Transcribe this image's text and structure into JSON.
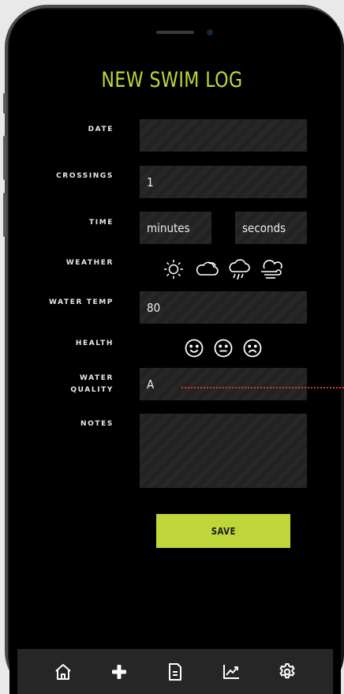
{
  "title": "NEW SWIM LOG",
  "form": {
    "date": {
      "label": "DATE",
      "value": ""
    },
    "crossings": {
      "label": "CROSSINGS",
      "value": "1"
    },
    "time": {
      "label": "TIME",
      "minutes_placeholder": "minutes",
      "seconds_placeholder": "seconds"
    },
    "weather": {
      "label": "WEATHER",
      "options": [
        "sun-icon",
        "cloud-icon",
        "rain-icon",
        "wind-icon"
      ]
    },
    "water_temp": {
      "label": "WATER TEMP",
      "value": "80"
    },
    "health": {
      "label": "HEALTH",
      "options": [
        "smile-icon",
        "neutral-face-icon",
        "frown-icon"
      ]
    },
    "water_quality": {
      "label_line1": "WATER",
      "label_line2": "QUALITY",
      "value": "A"
    },
    "notes": {
      "label": "NOTES",
      "value": ""
    }
  },
  "save_label": "SAVE",
  "nav": [
    "home-icon",
    "plus-icon",
    "document-icon",
    "chart-icon",
    "gear-icon"
  ],
  "colors": {
    "accent": "#bfd63a",
    "background": "#000000",
    "field": "#222222",
    "annotation": "#d13a3a"
  }
}
